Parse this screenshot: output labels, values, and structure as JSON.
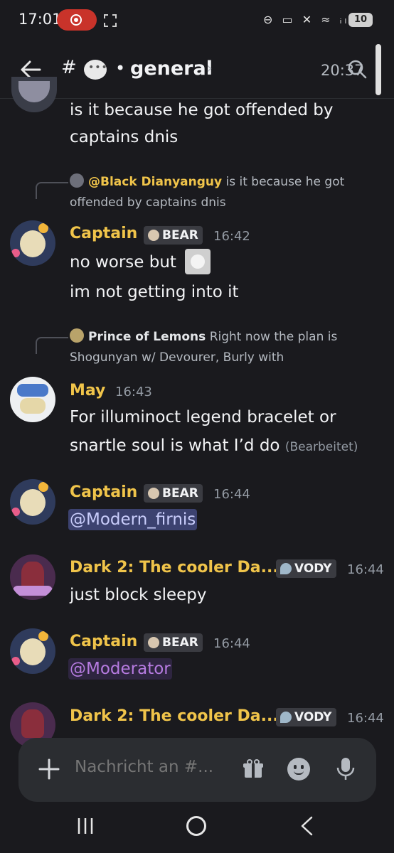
{
  "status_bar": {
    "time": "17:01",
    "status_icons": "⊖ ▭ ✕ ≈ ᵢₗ",
    "battery": "10"
  },
  "header": {
    "hash": "#",
    "separator": "•",
    "channel_name": "general",
    "chevron": "›",
    "time": "20:37"
  },
  "messages": [
    {
      "lines": [
        "is it because he got offended by",
        "captains dnis"
      ]
    },
    {
      "reply": {
        "author": "@Black Dianyanguy",
        "text_1": "is it because he got",
        "text_2": "offended by captains dnis"
      },
      "username": "Captain",
      "tag": "BEAR",
      "time": "16:42",
      "line_1": "no worse but",
      "line_2": "im not getting into it"
    },
    {
      "reply": {
        "author": "Prince of Lemons",
        "text_1": "Right now the plan is",
        "text_2": "Shogunyan w/ Devourer, Burly with"
      },
      "username": "May",
      "time": "16:43",
      "line_1": "For illuminoct legend bracelet or",
      "line_2": "snartle soul is what I’d do",
      "edited": "(Bearbeitet)"
    },
    {
      "username": "Captain",
      "tag": "BEAR",
      "time": "16:44",
      "mention": "@Modern_firnis"
    },
    {
      "username": "Dark 2: The cooler Da...",
      "tag": "VODY",
      "time": "16:44",
      "line_1": "just block sleepy"
    },
    {
      "username": "Captain",
      "tag": "BEAR",
      "time": "16:44",
      "mention": "@Moderator"
    },
    {
      "username": "Dark 2: The cooler Da...",
      "tag": "VODY",
      "time": "16:44"
    }
  ],
  "composer": {
    "placeholder": "Nachricht an #..."
  },
  "colors": {
    "background": "#1a1a1e",
    "username_gold": "#f0c44a",
    "mention_blue_bg": "#3c4270",
    "mention_purple": "#b67be0",
    "recording_red": "#c9332a"
  },
  "icons": [
    "back-arrow-icon",
    "search-icon",
    "plus-icon",
    "gift-icon",
    "emoji-icon",
    "mic-icon",
    "screenshot-icon",
    "recording-icon"
  ]
}
